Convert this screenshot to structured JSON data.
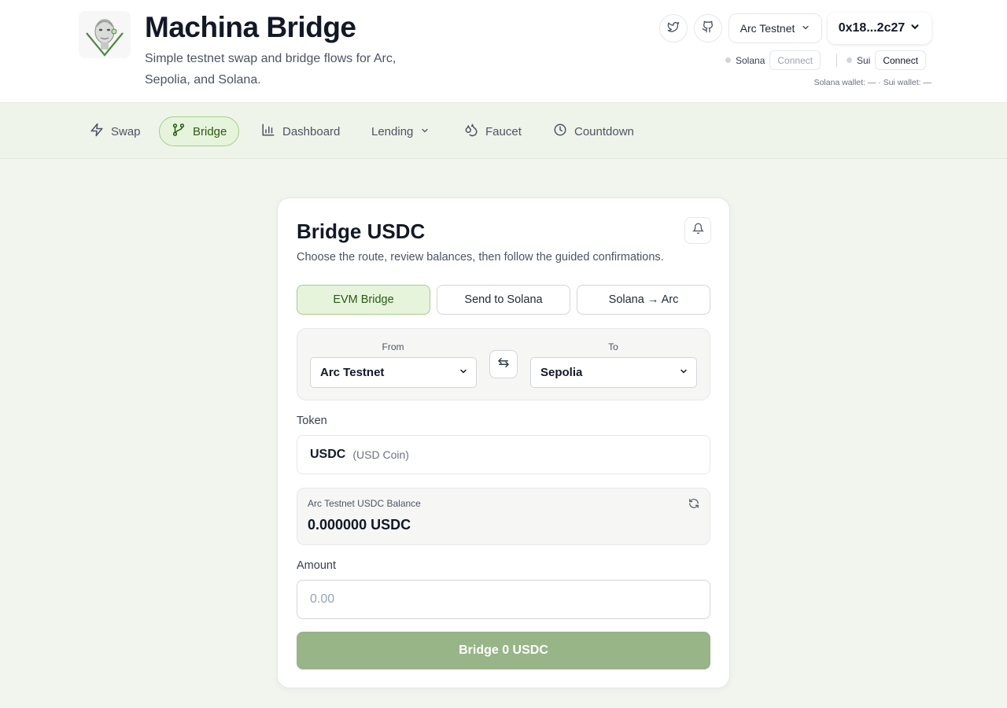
{
  "header": {
    "title": "Machina Bridge",
    "subtitle": "Simple testnet swap and bridge flows for Arc, Sepolia, and Solana.",
    "network": "Arc Testnet",
    "wallet_address": "0x18...2c27",
    "chains": [
      {
        "name": "Solana",
        "connect_label": "Connect"
      },
      {
        "name": "Sui",
        "connect_label": "Connect"
      }
    ],
    "wallet_status": "Solana wallet: — · Sui wallet: —"
  },
  "nav": {
    "items": [
      {
        "label": "Swap",
        "icon": "bolt-icon"
      },
      {
        "label": "Bridge",
        "icon": "git-branch-icon",
        "active": true
      },
      {
        "label": "Dashboard",
        "icon": "bar-chart-icon"
      },
      {
        "label": "Lending",
        "icon": "chevron-down-icon"
      },
      {
        "label": "Faucet",
        "icon": "droplets-icon"
      },
      {
        "label": "Countdown",
        "icon": "clock-icon"
      }
    ]
  },
  "card": {
    "title": "Bridge USDC",
    "description": "Choose the route, review balances, then follow the guided confirmations.",
    "routes": [
      "EVM Bridge",
      "Send to Solana",
      "Solana → Arc"
    ],
    "from_label": "From",
    "from_value": "Arc Testnet",
    "to_label": "To",
    "to_value": "Sepolia",
    "token_label": "Token",
    "token_symbol": "USDC",
    "token_name": "(USD Coin)",
    "balance_label": "Arc Testnet USDC Balance",
    "balance_value": "0.000000 USDC",
    "amount_label": "Amount",
    "amount_placeholder": "0.00",
    "submit_label": "Bridge 0 USDC"
  },
  "colors": {
    "accent": "#97b586",
    "active_bg": "#e6f4dc",
    "active_border": "#a3cf88",
    "active_text": "#2d5a12"
  }
}
